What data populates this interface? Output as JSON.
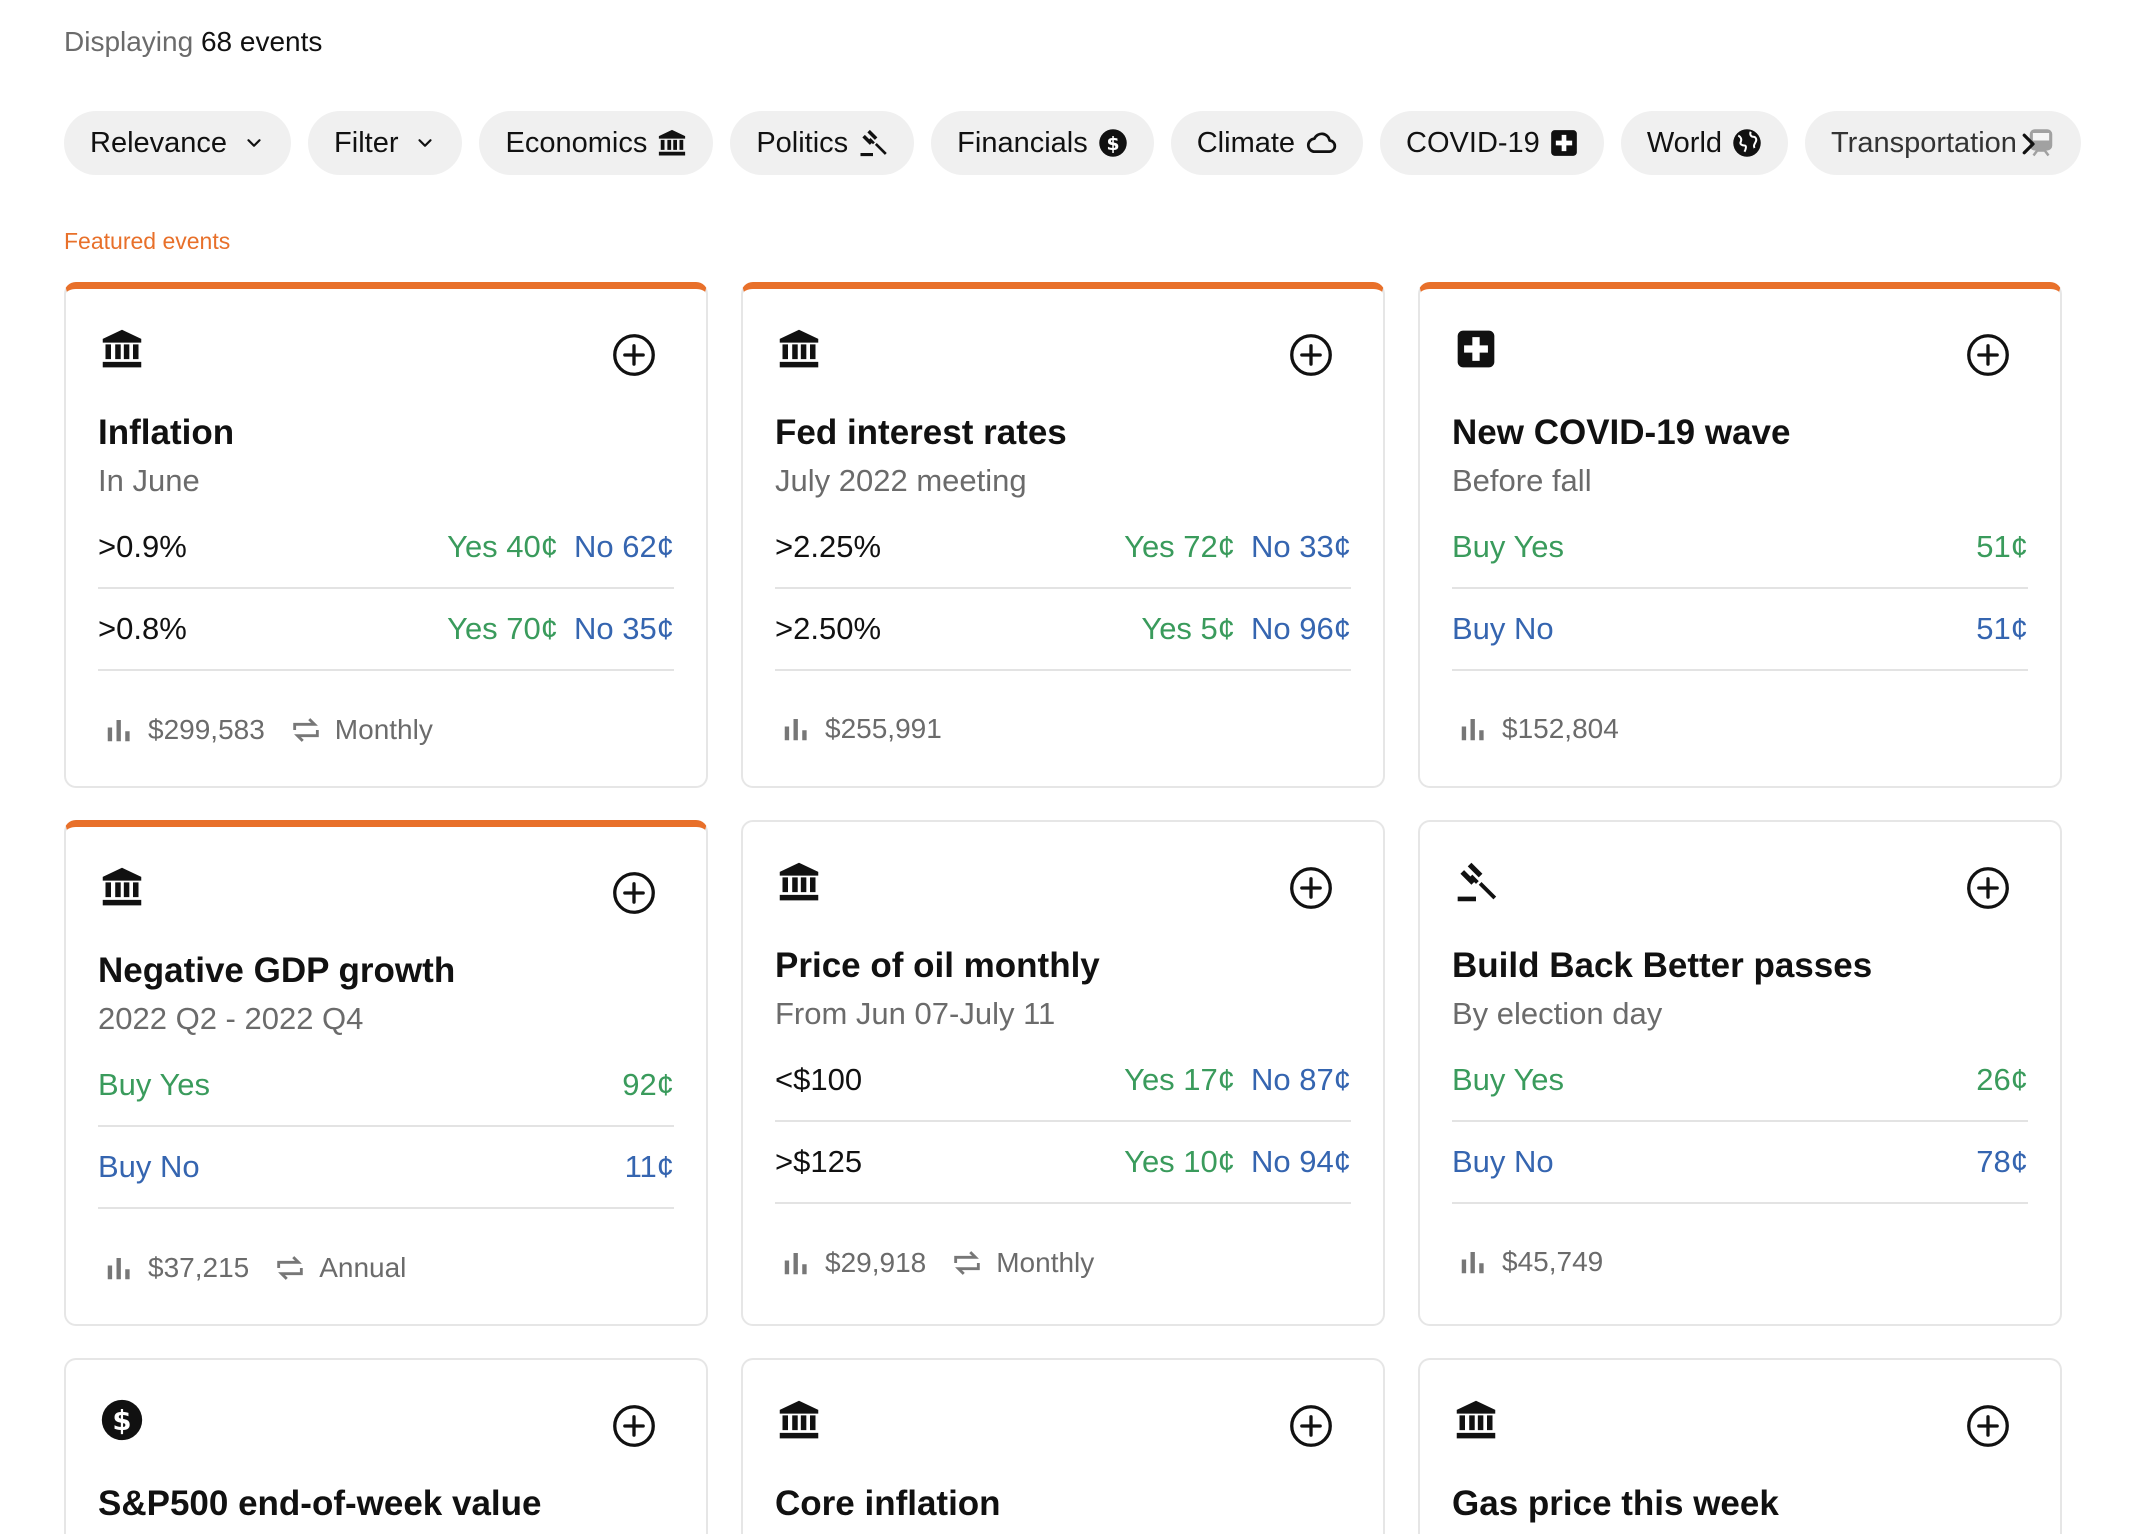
{
  "header": {
    "count_prefix": "Displaying",
    "count_value": "68 events"
  },
  "chips": [
    {
      "label": "Relevance",
      "icon": "chevron-down-icon"
    },
    {
      "label": "Filter",
      "icon": "chevron-down-icon"
    },
    {
      "label": "Economics",
      "icon": "bank-icon"
    },
    {
      "label": "Politics",
      "icon": "gavel-icon"
    },
    {
      "label": "Financials",
      "icon": "dollar-icon"
    },
    {
      "label": "Climate",
      "icon": "cloud-icon"
    },
    {
      "label": "COVID-19",
      "icon": "medical-cross-icon"
    },
    {
      "label": "World",
      "icon": "globe-icon"
    },
    {
      "label": "Transportation",
      "icon": "train-icon"
    }
  ],
  "section_label": "Featured events",
  "cards": [
    {
      "icon": "bank-icon",
      "title": "Inflation",
      "subtitle": "In June",
      "featured": true,
      "markets": [
        {
          "label": ">0.9%",
          "yes": "Yes 40¢",
          "no": "No 62¢"
        },
        {
          "label": ">0.8%",
          "yes": "Yes 70¢",
          "no": "No 35¢"
        }
      ],
      "volume": "$299,583",
      "frequency": "Monthly"
    },
    {
      "icon": "bank-icon",
      "title": "Fed interest rates",
      "subtitle": "July 2022 meeting",
      "featured": true,
      "markets": [
        {
          "label": ">2.25%",
          "yes": "Yes 72¢",
          "no": "No 33¢"
        },
        {
          "label": ">2.50%",
          "yes": "Yes 5¢",
          "no": "No 96¢"
        }
      ],
      "volume": "$255,991",
      "frequency": ""
    },
    {
      "icon": "medical-cross-icon",
      "title": "New COVID-19 wave",
      "subtitle": "Before fall",
      "featured": true,
      "binary": {
        "buy_yes": "Buy Yes",
        "yes_price": "51¢",
        "buy_no": "Buy No",
        "no_price": "51¢"
      },
      "volume": "$152,804",
      "frequency": ""
    },
    {
      "icon": "bank-icon",
      "title": "Negative GDP growth",
      "subtitle": "2022 Q2 - 2022 Q4",
      "featured": true,
      "binary": {
        "buy_yes": "Buy Yes",
        "yes_price": "92¢",
        "buy_no": "Buy No",
        "no_price": "11¢"
      },
      "volume": "$37,215",
      "frequency": "Annual"
    },
    {
      "icon": "bank-icon",
      "title": "Price of oil monthly",
      "subtitle": "From Jun 07-July 11",
      "featured": false,
      "markets": [
        {
          "label": "<$100",
          "yes": "Yes 17¢",
          "no": "No 87¢"
        },
        {
          "label": ">$125",
          "yes": "Yes 10¢",
          "no": "No 94¢"
        }
      ],
      "volume": "$29,918",
      "frequency": "Monthly"
    },
    {
      "icon": "gavel-icon",
      "title": "Build Back Better passes",
      "subtitle": "By election day",
      "featured": false,
      "binary": {
        "buy_yes": "Buy Yes",
        "yes_price": "26¢",
        "buy_no": "Buy No",
        "no_price": "78¢"
      },
      "volume": "$45,749",
      "frequency": ""
    },
    {
      "icon": "dollar-icon",
      "title": "S&P500 end-of-week value",
      "featured": false
    },
    {
      "icon": "bank-icon",
      "title": "Core inflation",
      "featured": false
    },
    {
      "icon": "bank-icon",
      "title": "Gas price this week",
      "featured": false
    }
  ],
  "colors": {
    "accent": "#e8702a",
    "yes": "#3a9b5c",
    "no": "#3565b0",
    "muted": "#6b6b6b"
  }
}
